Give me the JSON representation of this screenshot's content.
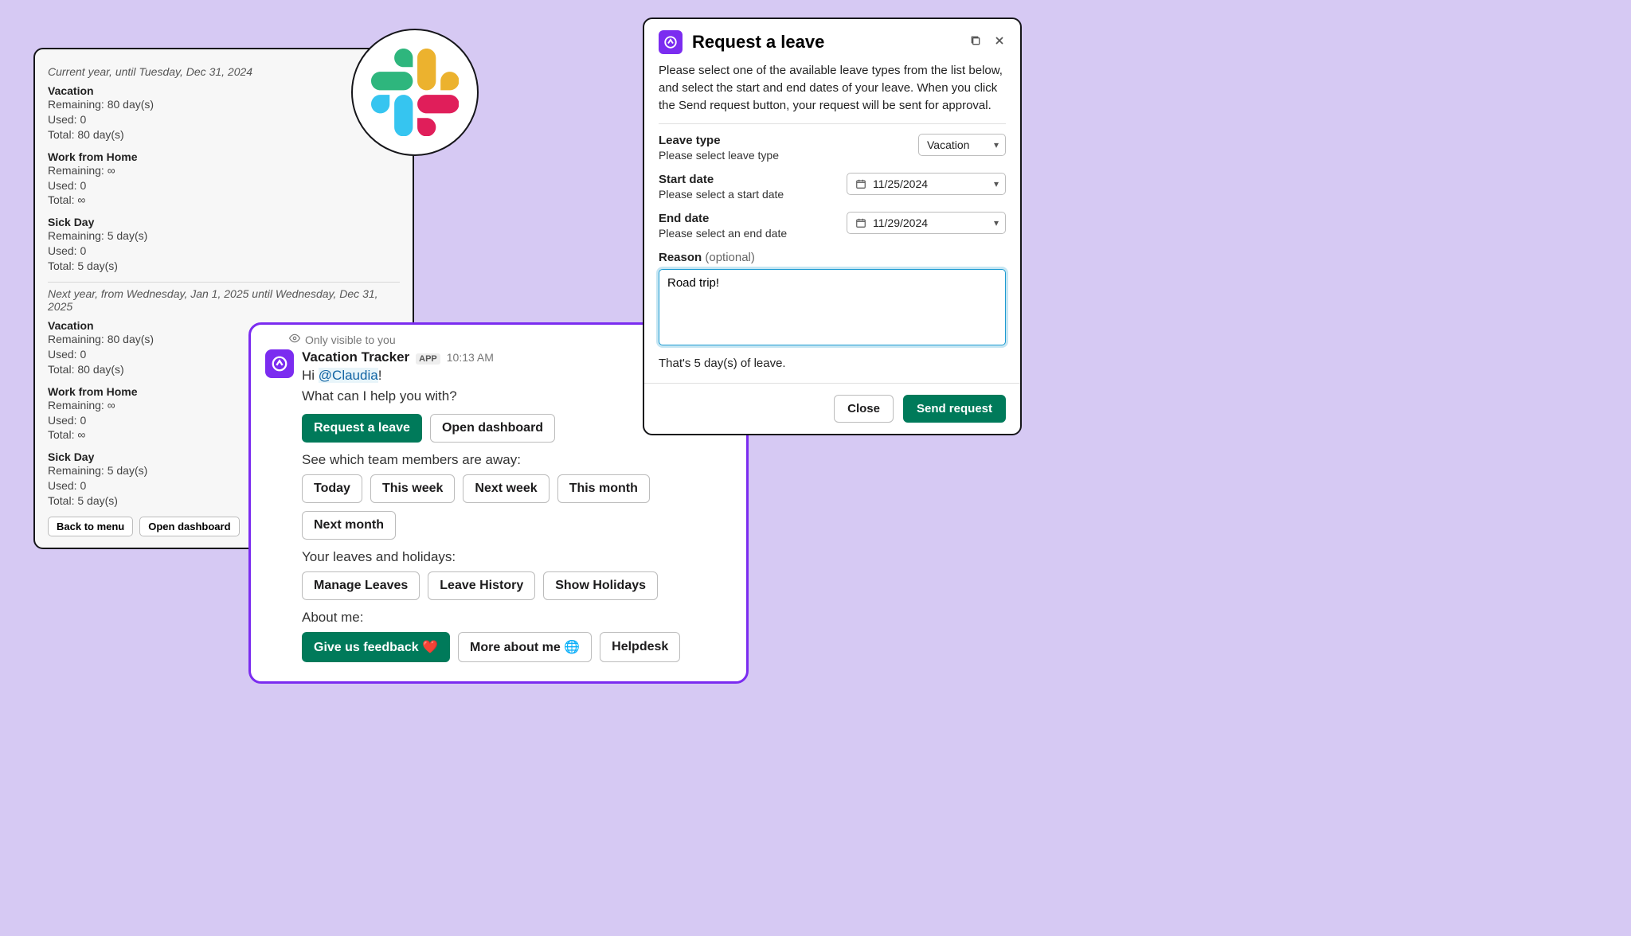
{
  "balance": {
    "current_period": "Current year, until Tuesday, Dec 31, 2024",
    "next_period": "Next year, from Wednesday, Jan 1, 2025 until Wednesday, Dec 31, 2025",
    "types_current": [
      {
        "name": "Vacation",
        "remaining": "Remaining: 80 day(s)",
        "used": "Used: 0",
        "total": "Total: 80 day(s)"
      },
      {
        "name": "Work from Home",
        "remaining": "Remaining: ∞",
        "used": "Used: 0",
        "total": "Total: ∞"
      },
      {
        "name": "Sick Day",
        "remaining": "Remaining: 5 day(s)",
        "used": "Used: 0",
        "total": "Total: 5 day(s)"
      }
    ],
    "types_next": [
      {
        "name": "Vacation",
        "remaining": "Remaining: 80 day(s)",
        "used": "Used: 0",
        "total": "Total: 80 day(s)"
      },
      {
        "name": "Work from Home",
        "remaining": "Remaining: ∞",
        "used": "Used: 0",
        "total": "Total: ∞"
      },
      {
        "name": "Sick Day",
        "remaining": "Remaining: 5 day(s)",
        "used": "Used: 0",
        "total": "Total: 5 day(s)"
      }
    ],
    "back_btn": "Back to menu",
    "open_dashboard_btn": "Open dashboard"
  },
  "bot": {
    "visibility": "Only visible to you",
    "name": "Vacation Tracker",
    "app_tag": "APP",
    "time": "10:13 AM",
    "greeting_prefix": "Hi ",
    "mention": "@Claudia",
    "greeting_suffix": "!",
    "prompt": "What can I help you with?",
    "request_leave": "Request a leave",
    "open_dashboard": "Open dashboard",
    "away_label": "See which team members are away:",
    "away_buttons": [
      "Today",
      "This week",
      "Next week",
      "This month",
      "Next month"
    ],
    "leaves_label": "Your leaves and holidays:",
    "leaves_buttons": [
      "Manage Leaves",
      "Leave History",
      "Show Holidays"
    ],
    "about_label": "About me:",
    "feedback_btn": "Give us feedback ❤️",
    "more_about_btn": "More about me 🌐",
    "helpdesk_btn": "Helpdesk"
  },
  "modal": {
    "title": "Request a leave",
    "intro": "Please select one of the available leave types from the list below, and select the start and end dates of your leave. When you click the Send request button, your request will be sent for approval.",
    "leave_type_label": "Leave type",
    "leave_type_hint": "Please select leave type",
    "leave_type_value": "Vacation",
    "start_label": "Start date",
    "start_hint": "Please select a start date",
    "start_value": "11/25/2024",
    "end_label": "End date",
    "end_hint": "Please select an end date",
    "end_value": "11/29/2024",
    "reason_label": "Reason",
    "reason_optional": " (optional)",
    "reason_value": "Road trip!",
    "days_summary": "That's 5 day(s) of leave.",
    "close_btn": "Close",
    "send_btn": "Send request"
  }
}
